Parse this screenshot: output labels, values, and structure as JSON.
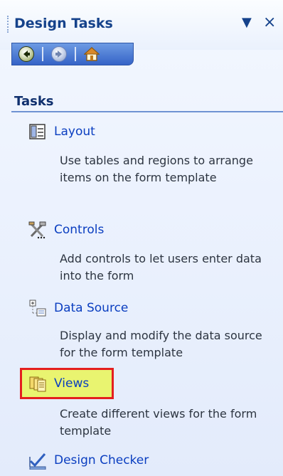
{
  "pane": {
    "title": "Design Tasks",
    "dropdown_glyph": "▼",
    "close_glyph": "×"
  },
  "nav": {
    "back_icon": "back-arrow-icon",
    "forward_icon": "forward-arrow-icon",
    "home_icon": "home-icon"
  },
  "section": {
    "title": "Tasks"
  },
  "tasks": [
    {
      "label": "Layout",
      "icon": "layout-icon",
      "description": "Use tables and regions to arrange items on the form template"
    },
    {
      "label": "Controls",
      "icon": "controls-icon",
      "description": "Add controls to let users enter data into the form"
    },
    {
      "label": "Data Source",
      "icon": "data-source-icon",
      "description": "Display and modify the data source for the form template"
    },
    {
      "label": "Views",
      "icon": "views-icon",
      "description": "Create different views for the form template",
      "highlighted": true
    },
    {
      "label": "Design Checker",
      "icon": "design-checker-icon",
      "description": ""
    }
  ],
  "colors": {
    "link": "#0a3ec0",
    "title": "#15428b",
    "highlight_fill": "#e9f470",
    "highlight_border": "#e41f1f"
  }
}
